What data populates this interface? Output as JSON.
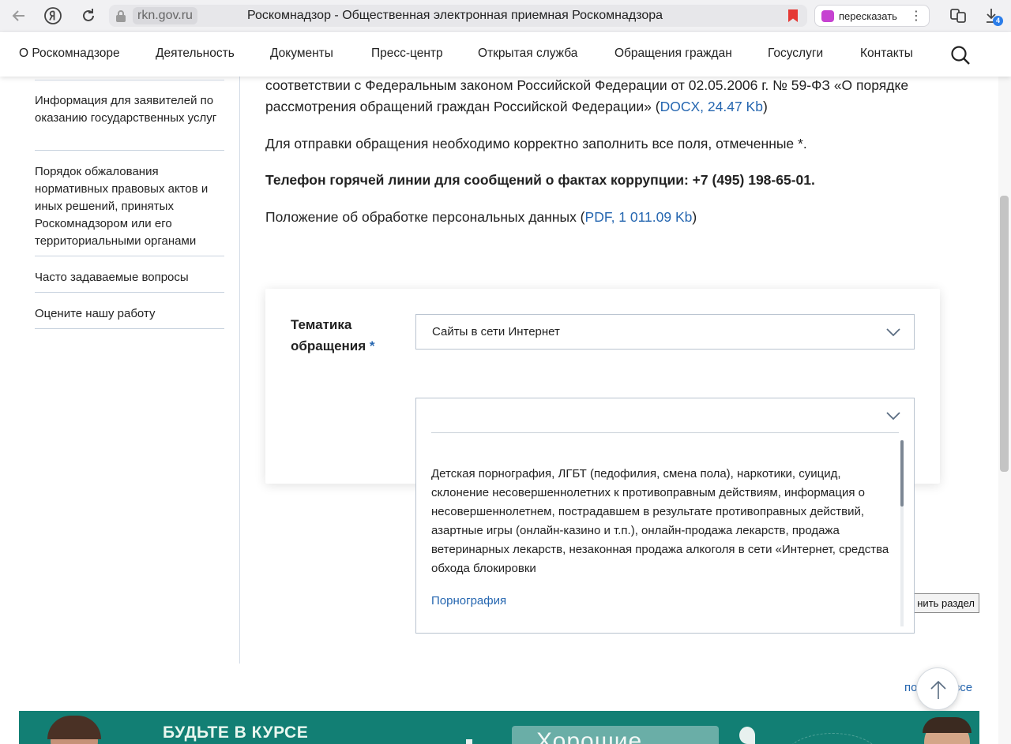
{
  "browser": {
    "domain": "rkn.gov.ru",
    "page_title": "Роскомнадзор - Общественная электронная приемная Роскомнадзора",
    "retell_label": "пересказать",
    "downloads_badge": "4"
  },
  "nav": {
    "items": [
      "О Роскомнадзоре",
      "Деятельность",
      "Документы",
      "Пресс-центр",
      "Открытая служба",
      "Обращения граждан",
      "Госуслуги",
      "Контакты"
    ]
  },
  "sidebar": {
    "items": [
      "Информация для заявителей по оказанию государственных услуг",
      "Порядок обжалования нормативных правовых актов и иных решений, принятых Роскомнадзором или его территориальными органами",
      "Часто задаваемые вопросы",
      "Оцените нашу работу"
    ]
  },
  "main": {
    "para1_text": "соответствии с Федеральным законом Российской Федерации от 02.05.2006 г. № 59-ФЗ «О порядке рассмотрения обращений граждан Российской Федерации» (",
    "para1_link": "DOCX, 24.47 Kb",
    "para1_end": ")",
    "para2": "Для отправки обращения необходимо корректно заполнить все поля, отмеченные *.",
    "para3": "Телефон горячей линии для сообщений о фактах коррупции: +7 (495) 198-65-01.",
    "para4_text": "Положение об обработке персональных данных (",
    "para4_link": "PDF, 1 011.09 Kb",
    "para4_end": ")"
  },
  "form": {
    "topic_label": "Тематика обращения",
    "required_mark": "*",
    "topic_value": "Сайты в сети Интернет",
    "subtopic_value": "",
    "dropdown_option_desc": "Детская порнография, ЛГБТ (педофилия, смена пола), наркотики, суицид, склонение несовершеннолетних к противоправным действиям, информация о несовершеннолетнем, пострадавшем в результате противоправных действий, азартные игры (онлайн-казино и т.п.), онлайн-продажа лекарств, продажа ветеринарных лекарств, незаконная продажа алкоголя в сети «Интернет, средства обхода блокировки",
    "dropdown_option_link": "Порнография"
  },
  "change_section_label": "нить раздел",
  "show_all_left": "по",
  "show_all_right": "все",
  "banner": {
    "title": "БУДЬТЕ В КУРСЕ",
    "word": "Хорошие"
  }
}
